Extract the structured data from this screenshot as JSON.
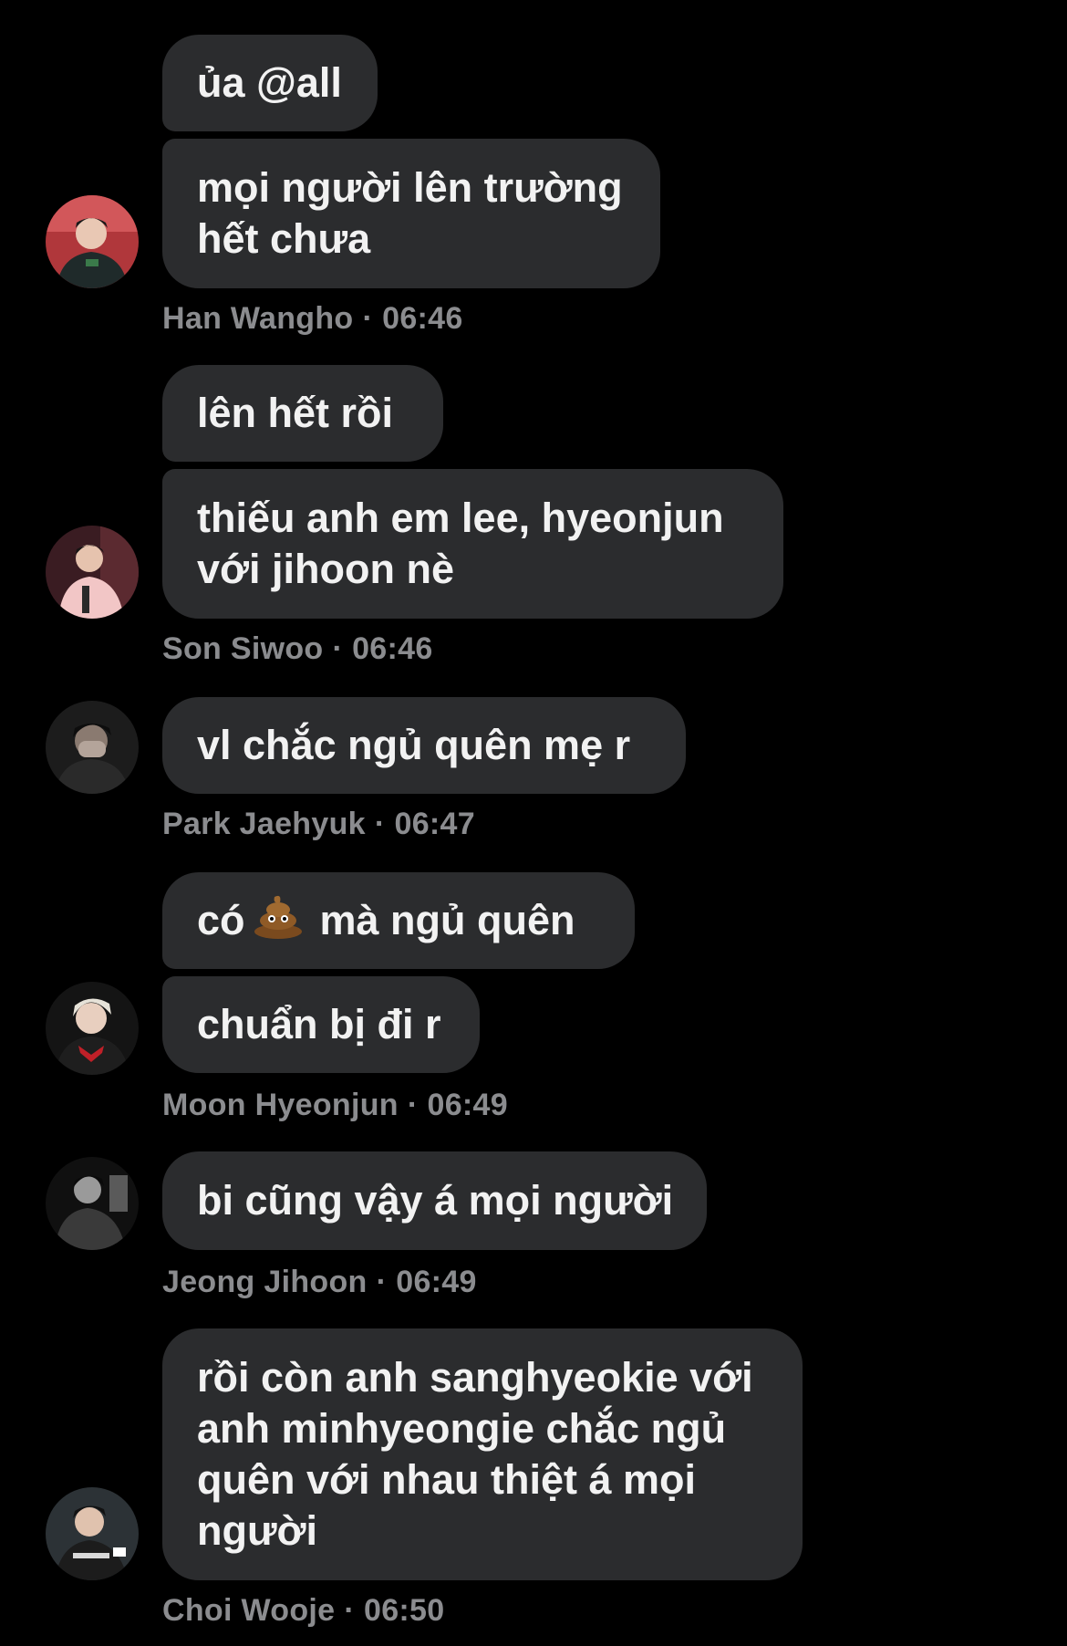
{
  "messages": [
    {
      "sender": "Han Wangho",
      "time": "06:46",
      "bubbles": [
        "ủa @all",
        "mọi người lên trường",
        "hết chưa"
      ]
    },
    {
      "sender": "Son Siwoo",
      "time": "06:46",
      "bubbles": [
        "lên hết rồi",
        "thiếu anh em lee, hyeonjun",
        "với jihoon nè"
      ]
    },
    {
      "sender": "Park Jaehyuk",
      "time": "06:47",
      "bubbles": [
        "vl chắc ngủ quên mẹ r"
      ]
    },
    {
      "sender": "Moon Hyeonjun",
      "time": "06:49",
      "bubbles": [
        "có",
        "mà ngủ quên",
        "chuẩn bị đi r"
      ]
    },
    {
      "sender": "Jeong Jihoon",
      "time": "06:49",
      "bubbles": [
        "bi cũng vậy á mọi người"
      ]
    },
    {
      "sender": "Choi Wooje",
      "time": "06:50",
      "bubbles": [
        "rồi còn anh sanghyeokie với",
        "anh minhyeongie chắc ngủ",
        "quên với nhau thiệt á mọi",
        "người"
      ]
    }
  ],
  "separator": "·",
  "colors": {
    "background": "#000000",
    "bubble": "#2b2c2e",
    "text": "#f2f2f2",
    "meta": "#8b8c8f"
  },
  "icons": {
    "poop": "pile-of-poo-emoji"
  }
}
